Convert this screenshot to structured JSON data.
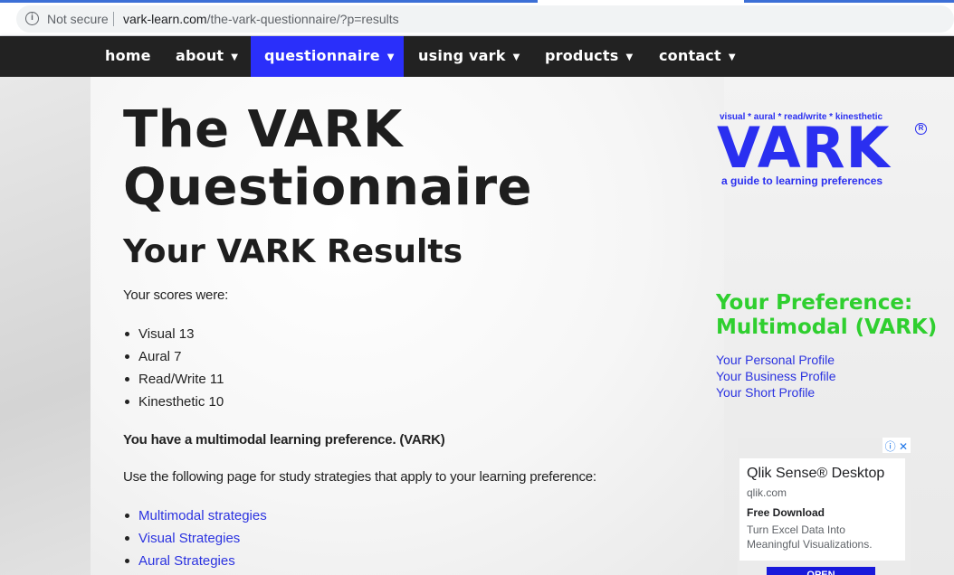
{
  "browser": {
    "security_label": "Not secure",
    "url_domain": "vark-learn.com",
    "url_path": "/the-vark-questionnaire/?p=results",
    "info_icon": "info-icon"
  },
  "nav": {
    "items": [
      {
        "label": "home",
        "has_caret": false,
        "active": false
      },
      {
        "label": "about",
        "has_caret": true,
        "active": false
      },
      {
        "label": "questionnaire",
        "has_caret": true,
        "active": true
      },
      {
        "label": "using vark",
        "has_caret": true,
        "active": false
      },
      {
        "label": "products",
        "has_caret": true,
        "active": false
      },
      {
        "label": "contact",
        "has_caret": true,
        "active": false
      }
    ],
    "caret": "▼",
    "active_color": "#2a2ffa",
    "bar_color": "#222222"
  },
  "main": {
    "title": "The VARK Questionnaire",
    "results_heading": "Your VARK Results",
    "scores_intro": "Your scores were:",
    "scores": [
      "Visual 13",
      "Aural 7",
      "Read/Write 11",
      "Kinesthetic 10"
    ],
    "preference_statement": "You have a multimodal learning preference. (VARK)",
    "strategies_intro": "Use the following page for study strategies that apply to your learning preference:",
    "strategy_links": [
      "Multimodal strategies",
      "Visual Strategies",
      "Aural Strategies"
    ]
  },
  "sidebar": {
    "logo": {
      "tagline_top": "visual * aural * read/write * kinesthetic",
      "wordmark": "VARK",
      "registered": "R",
      "tagline_bottom": "a guide to learning preferences",
      "color": "#2a2ff0"
    },
    "preference_title": "Your Preference: Multimodal (VARK)",
    "preference_color": "#2fcf2f",
    "profile_links": [
      "Your Personal Profile",
      "Your Business Profile",
      "Your Short Profile"
    ],
    "link_color": "#2b33e0"
  },
  "ad": {
    "controls": "ⓘ ✕",
    "title": "Qlik Sense® Desktop",
    "domain": "qlik.com",
    "subtitle": "Free Download",
    "description": "Turn Excel Data Into Meaningful Visualizations.",
    "button_label": "OPEN"
  }
}
